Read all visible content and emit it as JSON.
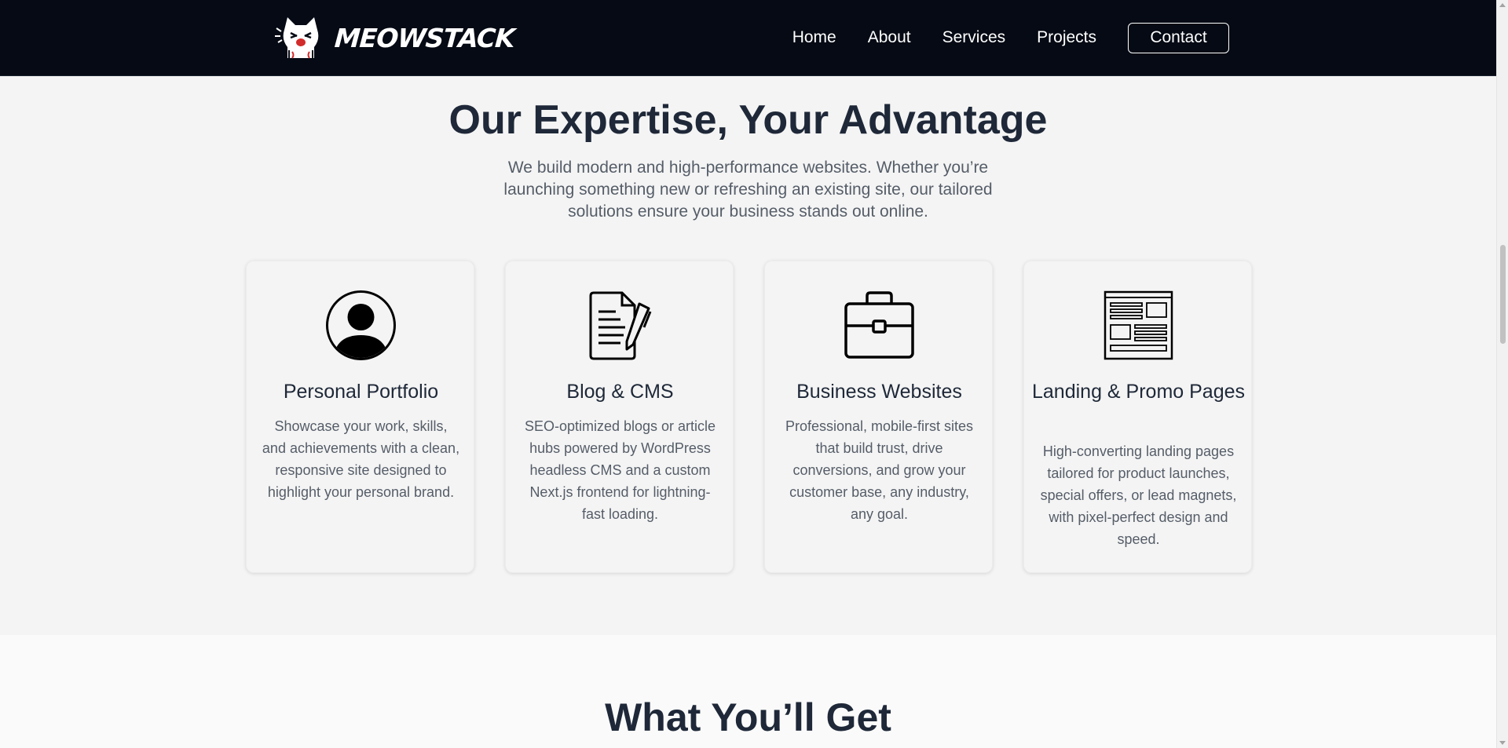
{
  "nav": {
    "brand": "MEOWSTACK",
    "links": [
      "Home",
      "About",
      "Services",
      "Projects"
    ],
    "contact": "Contact"
  },
  "expertise": {
    "title": "Our Expertise, Your Advantage",
    "subtitle": "We build modern and high-performance websites. Whether you’re launching something new or refreshing an existing site, our tailored solutions ensure your business stands out online.",
    "cards": [
      {
        "icon": "user-circle-icon",
        "title": "Personal Portfolio",
        "description": "Showcase your work, skills, and achievements with a clean, responsive site designed to highlight your personal brand."
      },
      {
        "icon": "document-pen-icon",
        "title": "Blog & CMS",
        "description": "SEO-optimized blogs or article hubs powered by WordPress headless CMS and a custom Next.js frontend for lightning-fast loading."
      },
      {
        "icon": "briefcase-icon",
        "title": "Business Websites",
        "description": "Professional, mobile-first sites that build trust, drive conversions, and grow your customer base, any industry, any goal."
      },
      {
        "icon": "newspaper-layout-icon",
        "title": "Landing & Promo Pages",
        "description": "High-converting landing pages tailored for product launches, special offers, or lead magnets, with pixel-perfect design and speed."
      }
    ]
  },
  "what_you_get": {
    "title": "What You’ll Get"
  }
}
